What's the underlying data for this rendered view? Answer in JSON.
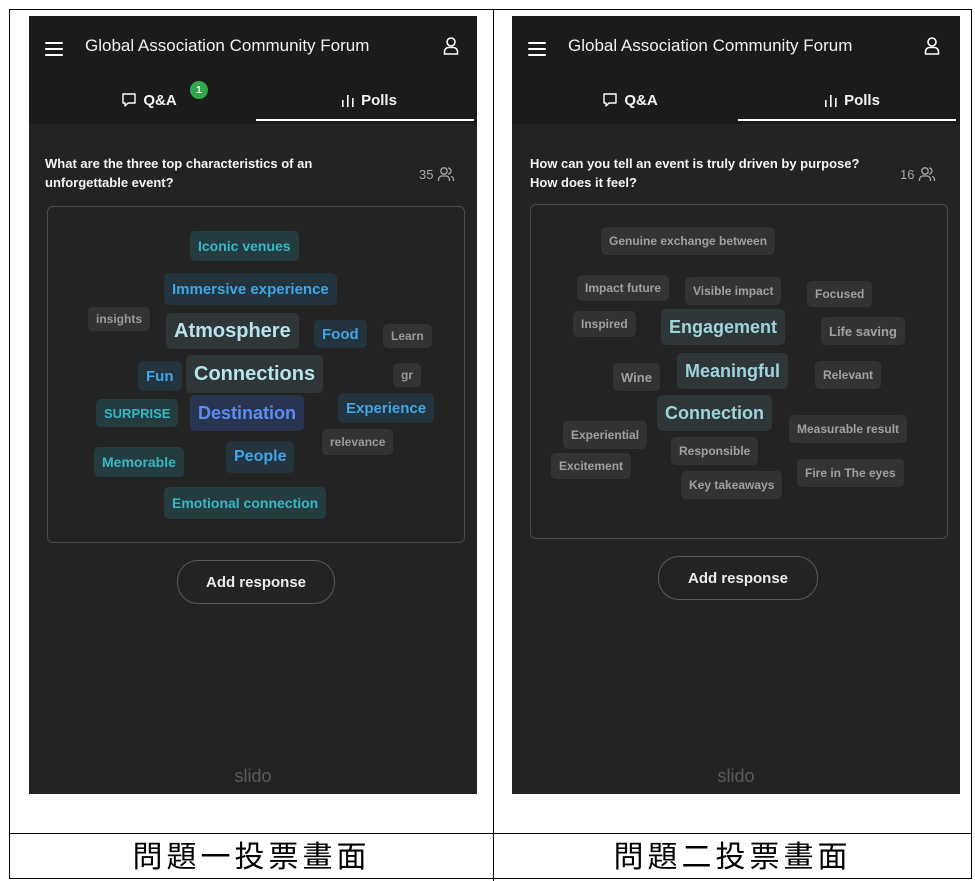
{
  "panels": [
    {
      "app_title": "Global Association Community Forum",
      "tabs": {
        "qa": "Q&A",
        "qa_badge": "1",
        "polls": "Polls",
        "active": "polls"
      },
      "question": "What are the three top characteristics of an unforgettable event?",
      "participants": "35",
      "words": [
        {
          "text": "Iconic venues",
          "color": "#39b6c4"
        },
        {
          "text": "Immersive experience",
          "color": "#3ea6e6"
        },
        {
          "text": "insights",
          "color": "#9a9a9a"
        },
        {
          "text": "Atmosphere",
          "color": "#b9e3ec"
        },
        {
          "text": "Food",
          "color": "#3ea6e6"
        },
        {
          "text": "Learn",
          "color": "#9a9a9a"
        },
        {
          "text": "Fun",
          "color": "#3ea6e6"
        },
        {
          "text": "Connections",
          "color": "#b9e3ec"
        },
        {
          "text": "gr",
          "color": "#9a9a9a"
        },
        {
          "text": "SURPRISE",
          "color": "#39b6c4"
        },
        {
          "text": "Destination",
          "color": "#5b8df0"
        },
        {
          "text": "Experience",
          "color": "#3ea6e6"
        },
        {
          "text": "relevance",
          "color": "#9a9a9a"
        },
        {
          "text": "Memorable",
          "color": "#39b6c4"
        },
        {
          "text": "People",
          "color": "#3ea6e6"
        },
        {
          "text": "Emotional connection",
          "color": "#39b6c4"
        }
      ],
      "add_response": "Add response",
      "brand": "slido",
      "caption": "問題一投票畫面"
    },
    {
      "app_title": "Global Association Community Forum",
      "tabs": {
        "qa": "Q&A",
        "polls": "Polls",
        "active": "polls"
      },
      "question": "How can you tell an event is truly driven by purpose? How does it feel?",
      "participants": "16",
      "words": [
        {
          "text": "Genuine exchange between",
          "color": "#a0a0a0"
        },
        {
          "text": "Impact future",
          "color": "#a0a0a0"
        },
        {
          "text": "Visible impact",
          "color": "#a0a0a0"
        },
        {
          "text": "Focused",
          "color": "#a0a0a0"
        },
        {
          "text": "Inspired",
          "color": "#a0a0a0"
        },
        {
          "text": "Engagement",
          "color": "#9fd4dc"
        },
        {
          "text": "Life saving",
          "color": "#a0a0a0"
        },
        {
          "text": "Wine",
          "color": "#a0a0a0"
        },
        {
          "text": "Meaningful",
          "color": "#9fd4dc"
        },
        {
          "text": "Relevant",
          "color": "#a0a0a0"
        },
        {
          "text": "Connection",
          "color": "#9fd4dc"
        },
        {
          "text": "Experiential",
          "color": "#a0a0a0"
        },
        {
          "text": "Measurable result",
          "color": "#a0a0a0"
        },
        {
          "text": "Responsible",
          "color": "#a0a0a0"
        },
        {
          "text": "Excitement",
          "color": "#a0a0a0"
        },
        {
          "text": "Fire in The eyes",
          "color": "#a0a0a0"
        },
        {
          "text": "Key takeaways",
          "color": "#a0a0a0"
        }
      ],
      "add_response": "Add response",
      "brand": "slido",
      "caption": "問題二投票畫面"
    }
  ],
  "colors": {
    "panel_bg": "#232323",
    "header_bg": "#1b1b1b",
    "badge": "#2eaa4a"
  }
}
